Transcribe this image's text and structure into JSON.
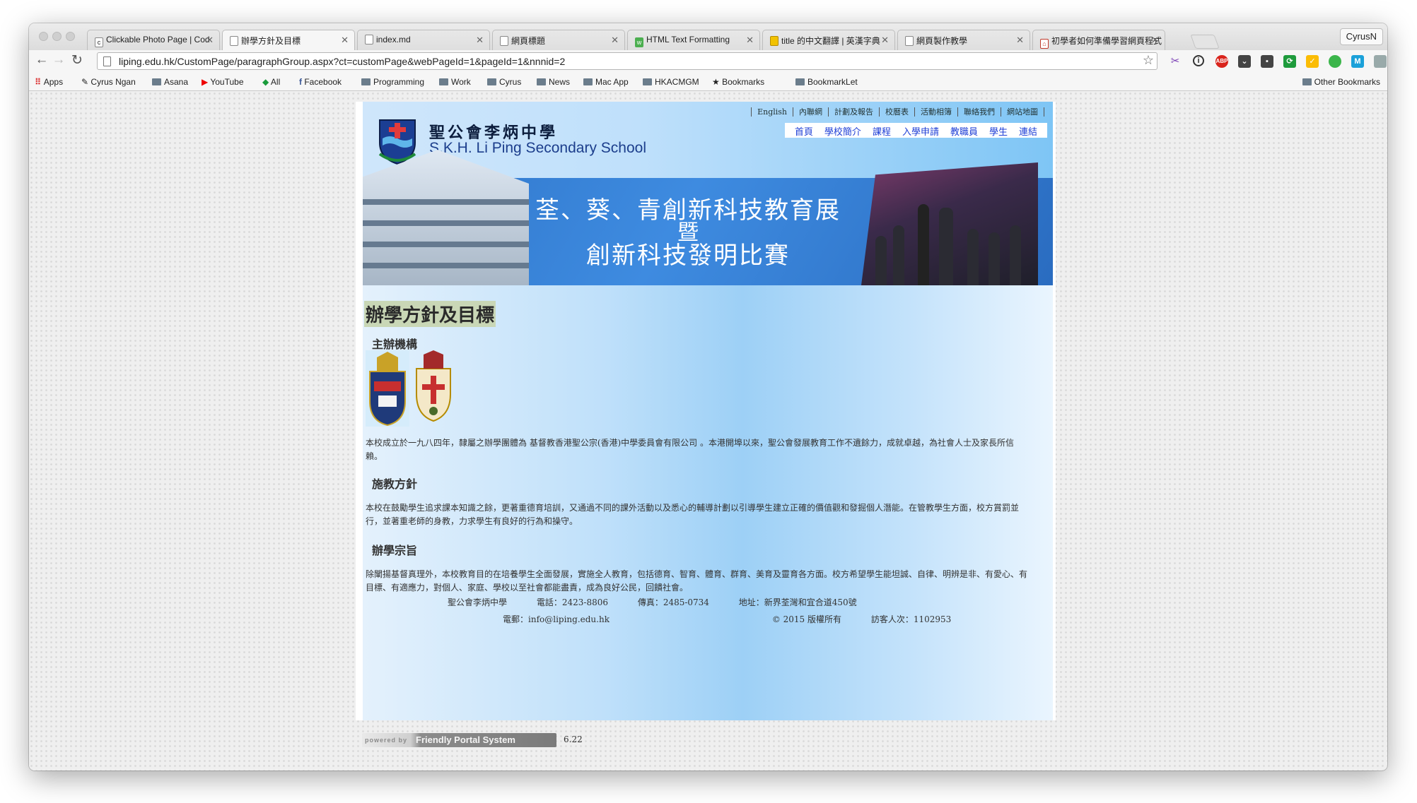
{
  "browser": {
    "tabs": [
      {
        "title": "Clickable Photo Page | Cod",
        "favicon": "c-icon"
      },
      {
        "title": "辦學方針及目標",
        "favicon": "page-icon",
        "active": true
      },
      {
        "title": "index.md",
        "favicon": "page-icon"
      },
      {
        "title": "網頁標題",
        "favicon": "page-icon"
      },
      {
        "title": "HTML Text Formatting",
        "favicon": "w3-icon"
      },
      {
        "title": "title 的中文翻譯 | 英漢字典",
        "favicon": "dict-icon"
      },
      {
        "title": "網頁製作教學",
        "favicon": "page-icon"
      },
      {
        "title": "初學者如何準備學習網頁程式",
        "favicon": "home-icon"
      }
    ],
    "profile": "CyrusN",
    "url": "liping.edu.hk/CustomPage/paragraphGroup.aspx?ct=customPage&webPageId=1&pageId=1&nnnid=2",
    "bookmarks": [
      "Apps",
      "Cyrus Ngan",
      "Asana",
      "YouTube",
      "All",
      "Facebook",
      "Programming",
      "Work",
      "Cyrus",
      "News",
      "Mac App",
      "HKACMGM",
      "Bookmarks",
      "BookmarkLet"
    ],
    "other_bookmarks": "Other Bookmarks"
  },
  "site": {
    "school_name_zh": "聖公會李炳中學",
    "school_name_en": "S.K.H. Li Ping Secondary School",
    "top_links": [
      "English",
      "內聯網",
      "計劃及報告",
      "校曆表",
      "活動相簿",
      "聯絡我們",
      "網站地圖"
    ],
    "main_nav": [
      "首頁",
      "學校簡介",
      "課程",
      "入學申請",
      "教職員",
      "學生",
      "連結"
    ],
    "banner": {
      "line1": "荃、葵、青創新科技教育展",
      "line2": "暨",
      "line3": "創新科技發明比賽"
    },
    "page_title": "辦學方針及目標",
    "sections": [
      {
        "heading": "主辦機構",
        "text": "本校成立於一九八四年，隸屬之辦學團體為 基督教香港聖公宗(香港)中學委員會有限公司 。本港開埠以來，聖公會發展教育工作不遺餘力，成就卓越，為社會人士及家長所信賴。"
      },
      {
        "heading": "施教方針",
        "text": "本校在鼓勵學生追求課本知識之餘，更著重德育培訓，又通過不同的課外活動以及悉心的輔導計劃以引導學生建立正確的價值觀和發掘個人潛能。在管教學生方面，校方賞罰並行，並著重老師的身教，力求學生有良好的行為和操守。"
      },
      {
        "heading": "辦學宗旨",
        "text": "除闡揚基督真理外，本校教育目的在培養學生全面發展，實施全人教育，包括德育、智育、體育、群育、美育及靈育各方面。校方希望學生能坦誠、自律、明辨是非、有愛心、有目標、有適應力，對個人、家庭、學校以至社會都能盡責，成為良好公民，回饋社會。"
      }
    ],
    "footer": {
      "name": "聖公會李炳中學",
      "phone": "電話：2423-8806",
      "fax": "傳真：2485-0734",
      "address": "地址：新界荃灣和宜合道450號",
      "email": "電郵：info@liping.edu.hk",
      "copyright": "© 2015 版權所有",
      "visitors": "訪客人次：1102953"
    },
    "powered_small": "powered by",
    "powered_brand": "Friendly Portal System",
    "version": "6.22"
  }
}
